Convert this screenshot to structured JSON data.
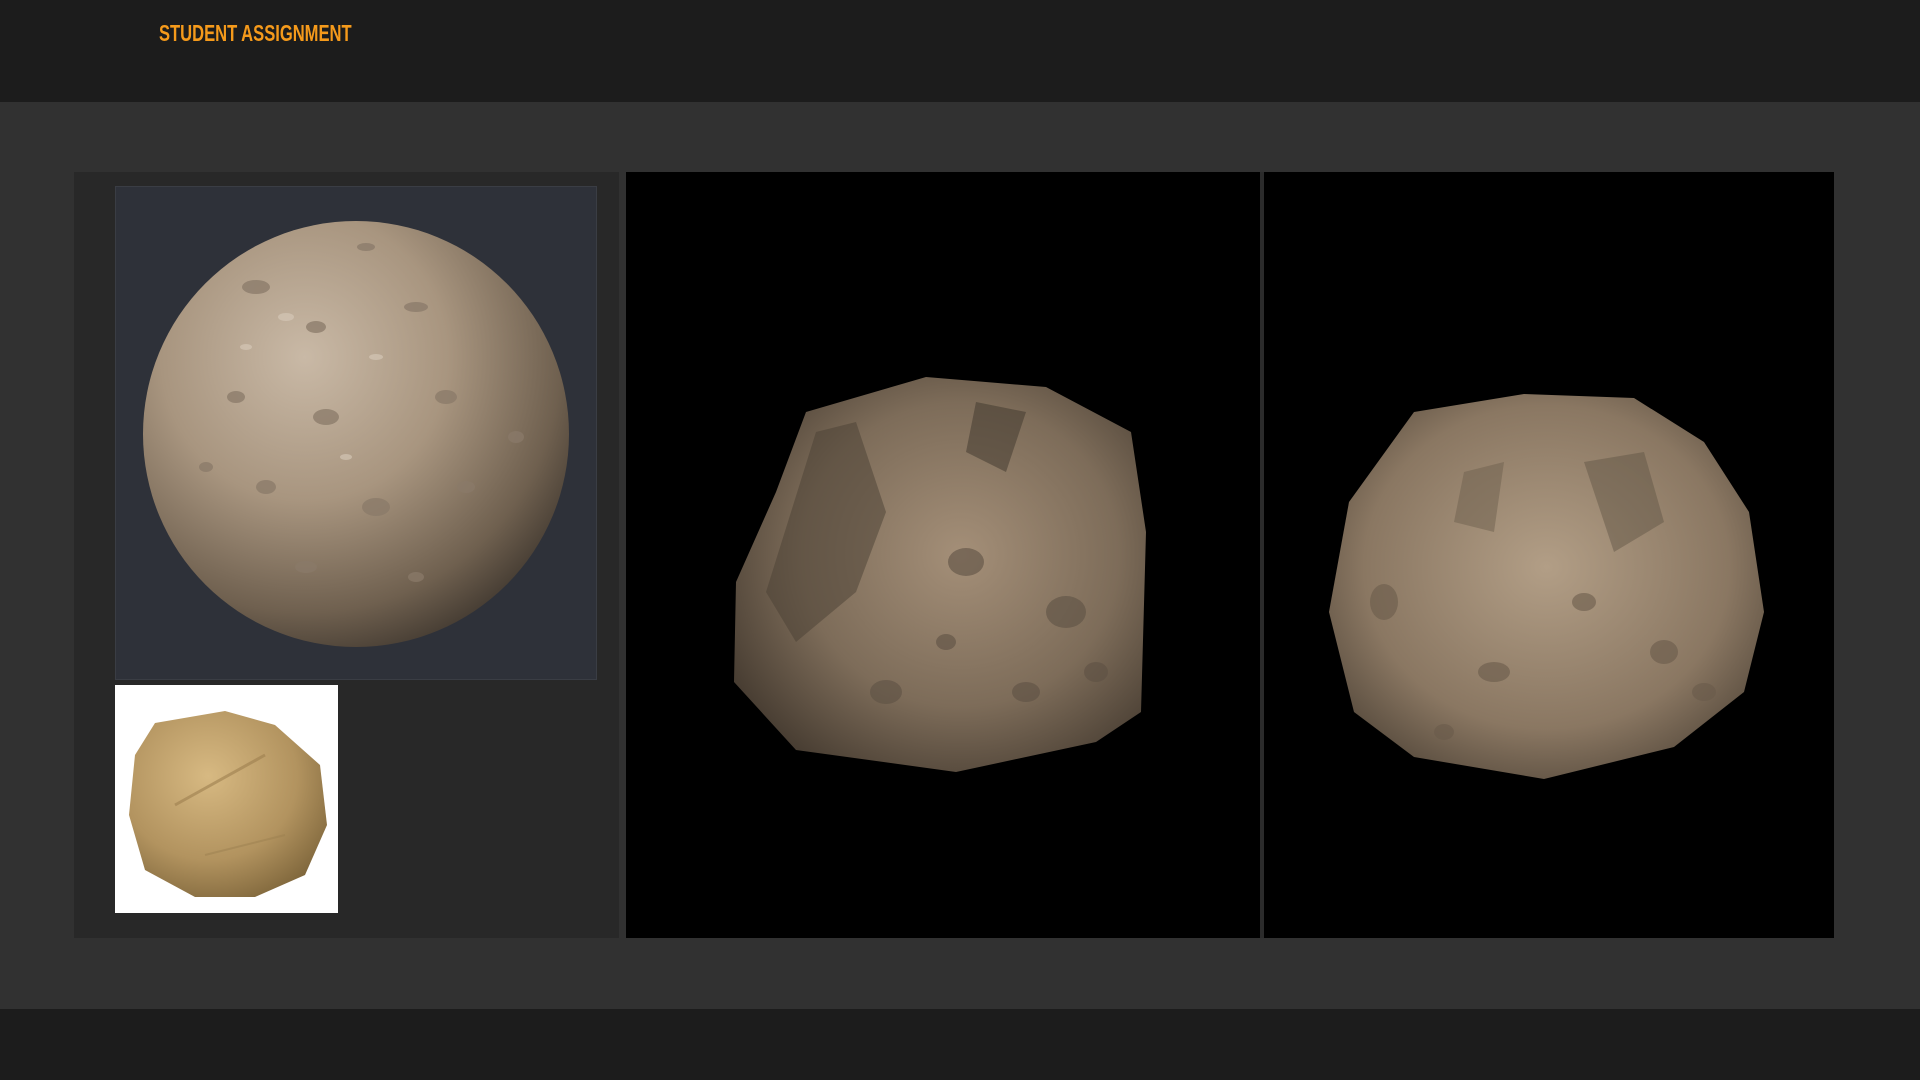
{
  "header": {
    "title": "STUDENT ASSIGNMENT",
    "accent_color": "#f59a1b"
  },
  "gallery": {
    "images": [
      {
        "name": "material-sphere-preview",
        "background": "#2e3139"
      },
      {
        "name": "reference-photo-rock",
        "background": "#ffffff"
      },
      {
        "name": "rock-render-angle-1",
        "background": "#000000"
      },
      {
        "name": "rock-render-angle-2",
        "background": "#000000"
      }
    ]
  }
}
